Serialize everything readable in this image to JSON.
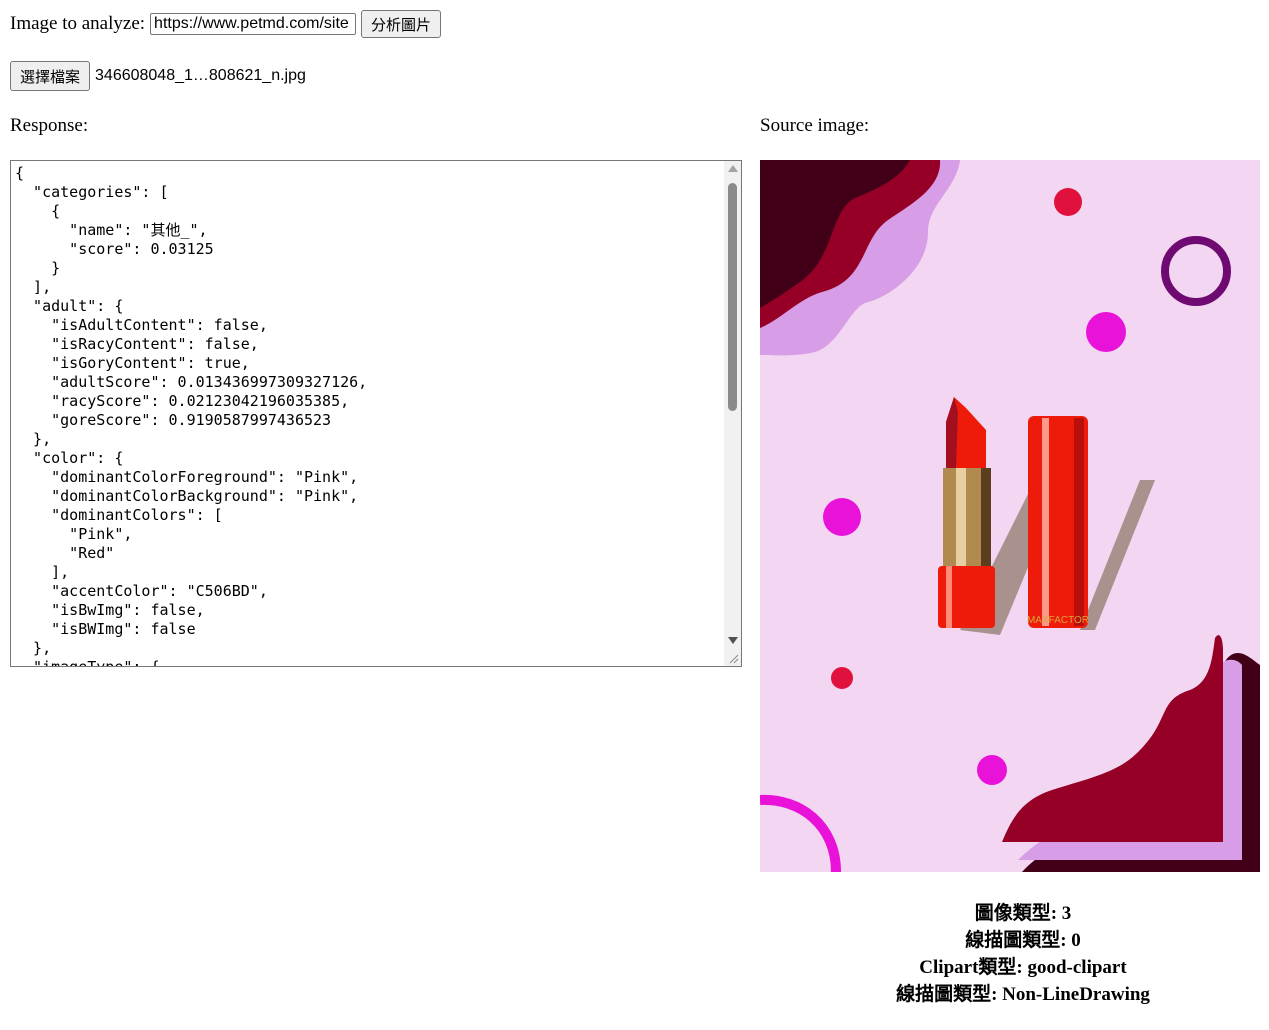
{
  "form": {
    "analyze_label": "Image to analyze:",
    "url_value": "https://www.petmd.com/site",
    "analyze_button": "分析圖片",
    "file_button": "選擇檔案",
    "file_name": "346608048_1…808621_n.jpg"
  },
  "response": {
    "label": "Response:",
    "json_text": "{\n  \"categories\": [\n    {\n      \"name\": \"其他_\",\n      \"score\": 0.03125\n    }\n  ],\n  \"adult\": {\n    \"isAdultContent\": false,\n    \"isRacyContent\": false,\n    \"isGoryContent\": true,\n    \"adultScore\": 0.013436997309327126,\n    \"racyScore\": 0.02123042196035385,\n    \"goreScore\": 0.9190587997436523\n  },\n  \"color\": {\n    \"dominantColorForeground\": \"Pink\",\n    \"dominantColorBackground\": \"Pink\",\n    \"dominantColors\": [\n      \"Pink\",\n      \"Red\"\n    ],\n    \"accentColor\": \"C506BD\",\n    \"isBwImg\": false,\n    \"isBWImg\": false\n  },\n  \"imageType\": {"
  },
  "source": {
    "label": "Source image:",
    "image_text": "MAXFACTOR",
    "colors": {
      "background": "#f3d6f1",
      "wine": "#960027",
      "dark": "#420018",
      "lilac": "#d79de6",
      "magenta": "#e812d8",
      "red": "#e0123d",
      "purple": "#6e0a72",
      "lipstick": "#ee1b0b"
    }
  },
  "results": {
    "line1": "圖像類型: 3",
    "line2": "線描圖類型: 0",
    "line3": "Clipart類型: good-clipart",
    "line4": "線描圖類型: Non-LineDrawing"
  }
}
